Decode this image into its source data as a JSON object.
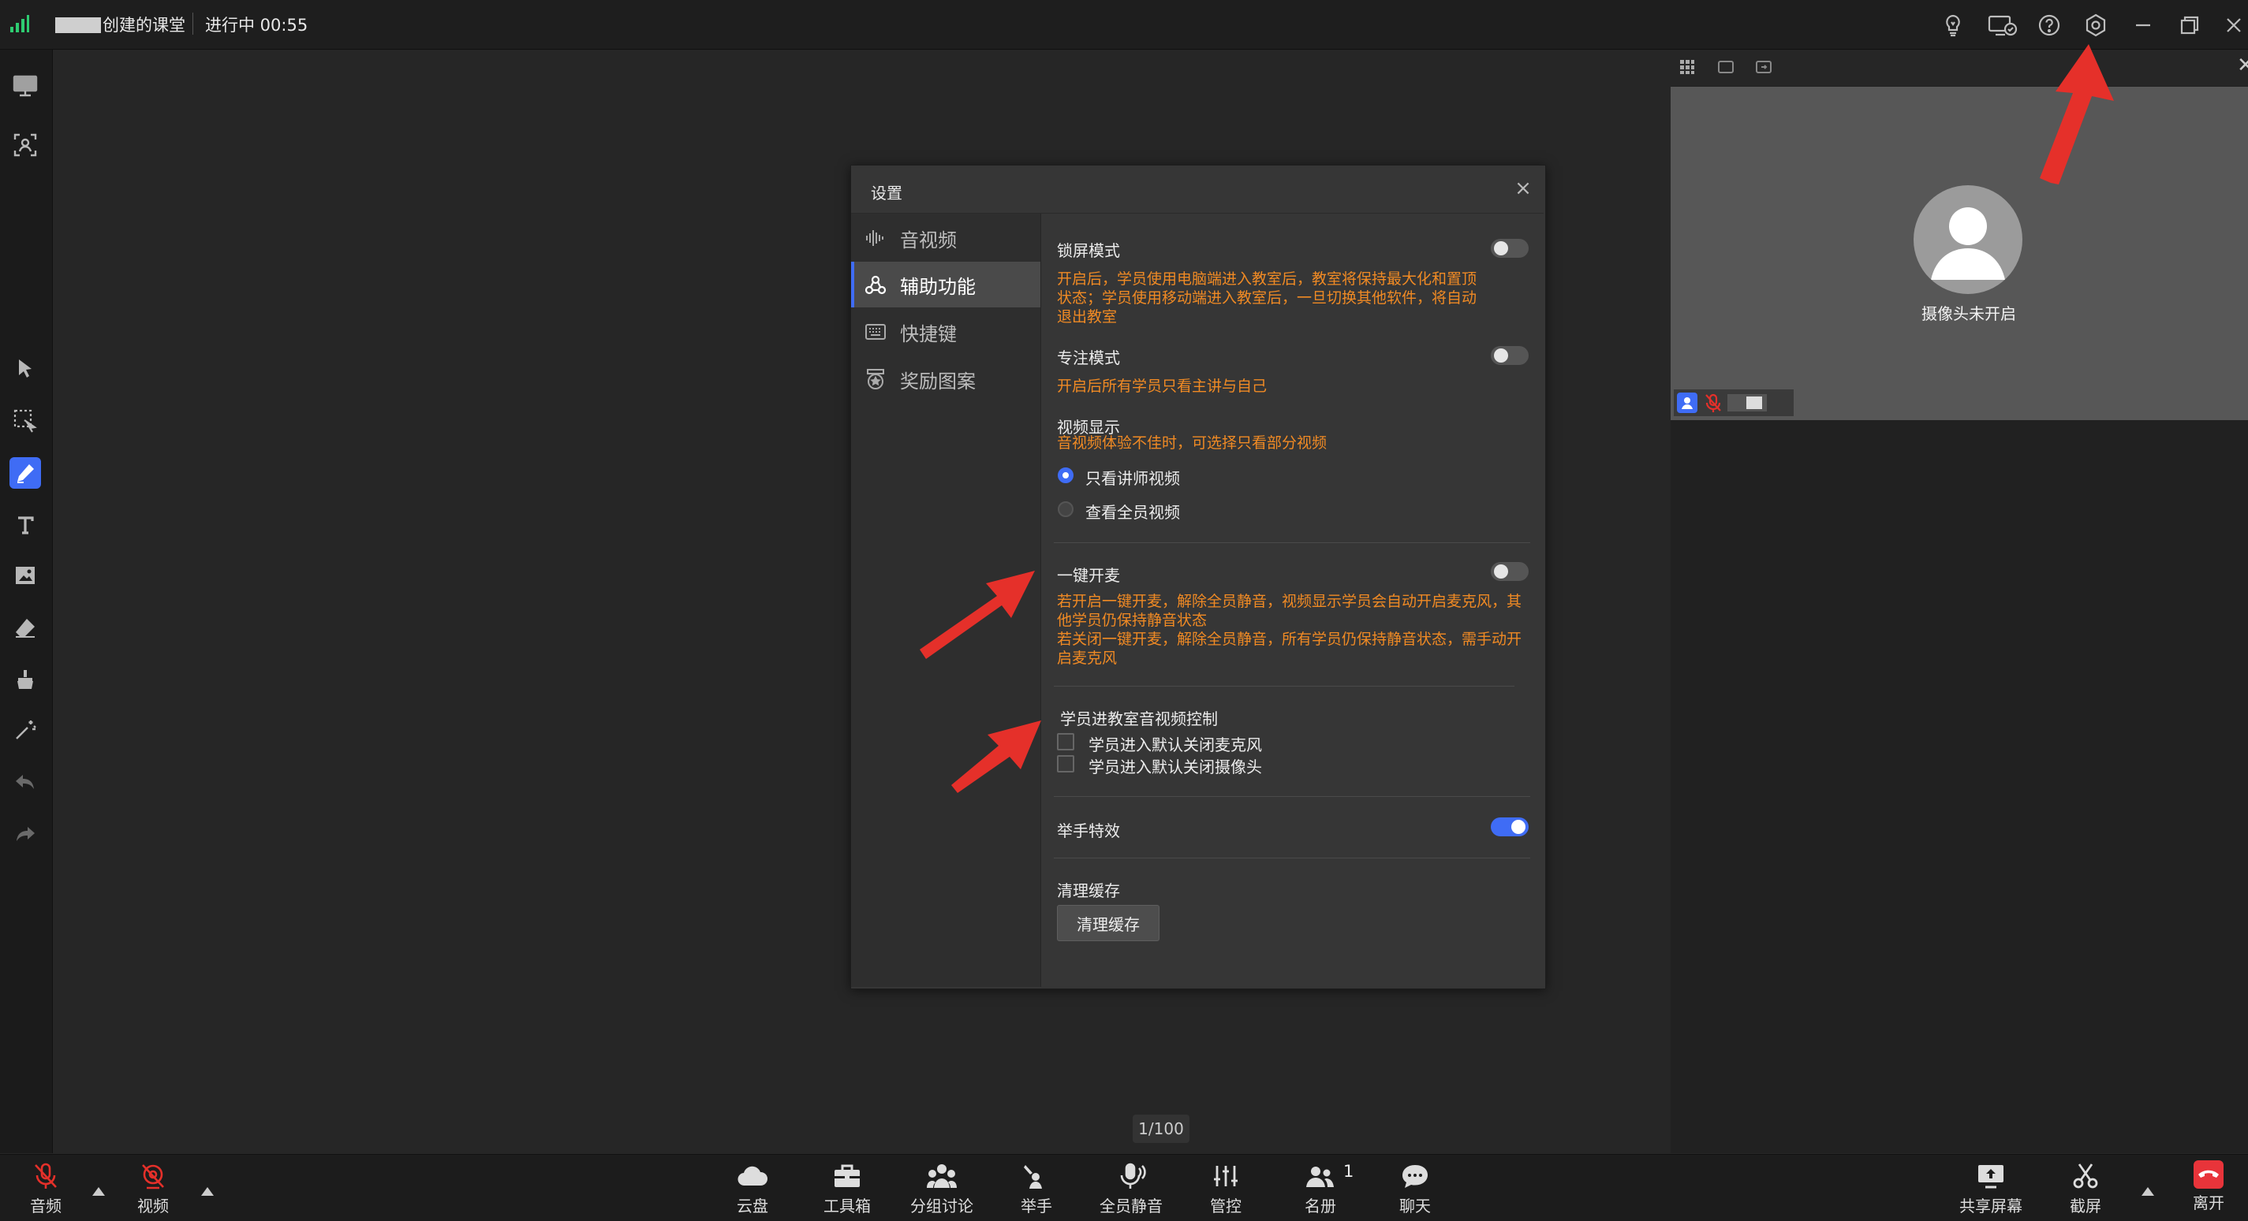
{
  "colors": {
    "accent": "#3f6cf5",
    "warning": "#f08a24",
    "annotation": "#e5302a",
    "leave": "#e8343a"
  },
  "topbar": {
    "room_name": "创建的课堂",
    "status": "进行中 00:55",
    "icons": [
      "signal-icon",
      "bulb-icon",
      "device-check-icon",
      "help-icon",
      "settings-icon",
      "minimize-icon",
      "restore-icon",
      "close-icon"
    ]
  },
  "left_toolbar": {
    "tools": [
      "whiteboard-icon",
      "member-video-icon",
      "select-icon",
      "box-select-icon",
      "pen-icon",
      "text-icon",
      "image-icon",
      "eraser-icon",
      "clear-icon",
      "laser-icon",
      "undo-icon",
      "redo-icon"
    ],
    "active_tool": "pen-icon"
  },
  "right_panel": {
    "camera_off_text": "摄像头未开启"
  },
  "settings_dialog": {
    "title": "设置",
    "nav": [
      {
        "label": "音视频",
        "icon": "audio-video-icon"
      },
      {
        "label": "辅助功能",
        "icon": "assist-icon",
        "selected": true
      },
      {
        "label": "快捷键",
        "icon": "keyboard-icon"
      },
      {
        "label": "奖励图案",
        "icon": "medal-icon"
      }
    ],
    "lock_screen": {
      "label": "锁屏模式",
      "enabled": false,
      "desc": "开启后，学员使用电脑端进入教室后，教室将保持最大化和置顶状态；学员使用移动端进入教室后，一旦切换其他软件，将自动退出教室"
    },
    "focus_mode": {
      "label": "专注模式",
      "enabled": false,
      "desc": "开启后所有学员只看主讲与自己"
    },
    "video_display": {
      "label": "视频显示",
      "desc": "音视频体验不佳时，可选择只看部分视频",
      "options": [
        "只看讲师视频",
        "查看全员视频"
      ],
      "selected": "只看讲师视频"
    },
    "one_key_mic": {
      "label": "一键开麦",
      "enabled": false,
      "desc_on": "若开启一键开麦，解除全员静音，视频显示学员会自动开启麦克风，其他学员仍保持静音状态",
      "desc_off": "若关闭一键开麦，解除全员静音，所有学员仍保持静音状态，需手动开启麦克风"
    },
    "entry_av_control": {
      "label": "学员进教室音视频控制",
      "options": [
        "学员进入默认关闭麦克风",
        "学员进入默认关闭摄像头"
      ]
    },
    "raise_hand_effect": {
      "label": "举手特效",
      "enabled": true
    },
    "clear_cache": {
      "label": "清理缓存",
      "button": "清理缓存"
    }
  },
  "page_indicator": "1/100",
  "bottom_bar": {
    "left": [
      {
        "label": "音频",
        "icon": "mic-off-icon"
      },
      {
        "label": "视频",
        "icon": "camera-off-icon"
      }
    ],
    "center": [
      {
        "label": "云盘",
        "icon": "cloud-icon"
      },
      {
        "label": "工具箱",
        "icon": "toolbox-icon"
      },
      {
        "label": "分组讨论",
        "icon": "group-icon"
      },
      {
        "label": "举手",
        "icon": "raise-hand-icon"
      },
      {
        "label": "全员静音",
        "icon": "mute-all-icon"
      },
      {
        "label": "管控",
        "icon": "control-icon"
      },
      {
        "label": "名册",
        "icon": "roster-icon",
        "badge": "1"
      },
      {
        "label": "聊天",
        "icon": "chat-icon"
      }
    ],
    "right": [
      {
        "label": "共享屏幕",
        "icon": "share-screen-icon"
      },
      {
        "label": "截屏",
        "icon": "scissors-icon"
      },
      {
        "label": "离开",
        "icon": "hangup-icon"
      }
    ]
  }
}
